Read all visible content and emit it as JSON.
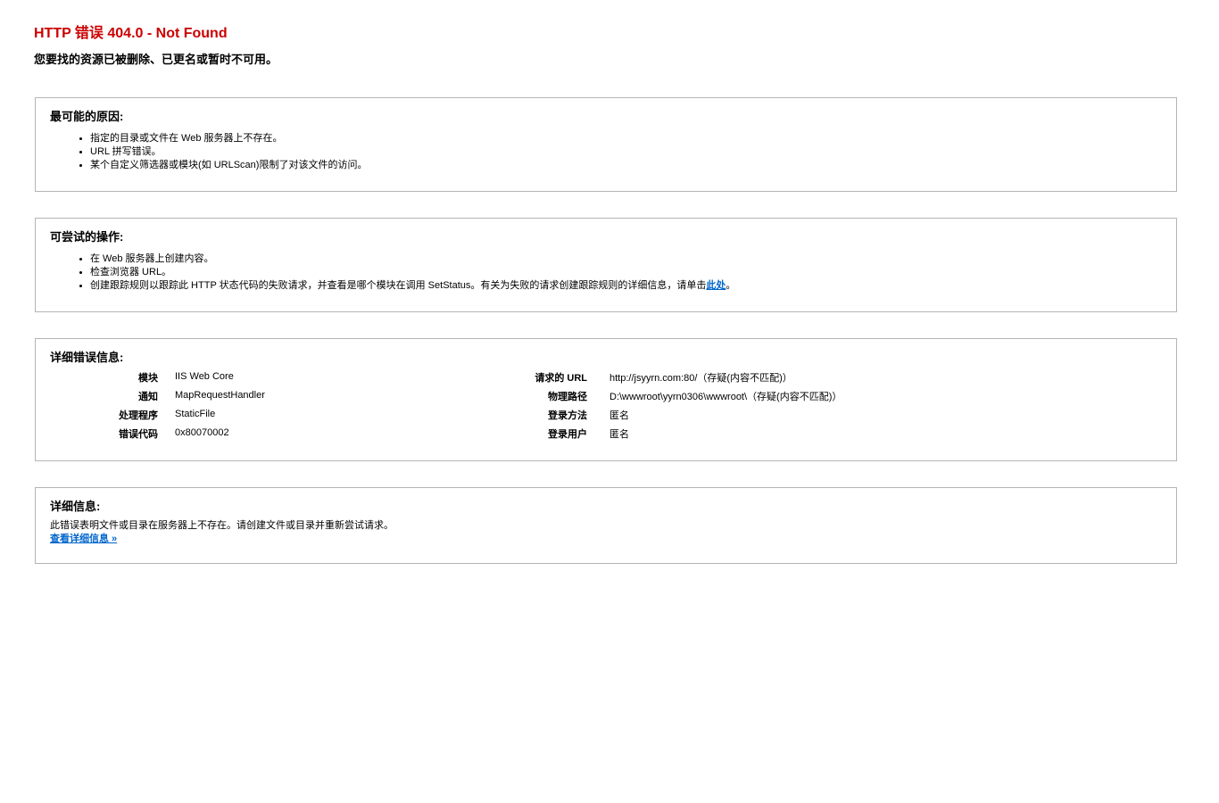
{
  "header": {
    "title": "HTTP 错误 404.0 - Not Found",
    "subtitle": "您要找的资源已被删除、已更名或暂时不可用。"
  },
  "causes": {
    "heading": "最可能的原因:",
    "items": [
      "指定的目录或文件在 Web 服务器上不存在。",
      "URL 拼写错误。",
      "某个自定义筛选器或模块(如 URLScan)限制了对该文件的访问。"
    ]
  },
  "actions": {
    "heading": "可尝试的操作:",
    "items": [
      "在 Web 服务器上创建内容。",
      "检查浏览器 URL。"
    ],
    "trace_text": "创建跟踪规则以跟踪此 HTTP 状态代码的失败请求，并查看是哪个模块在调用 SetStatus。有关为失败的请求创建跟踪规则的详细信息，请单击",
    "trace_link": "此处",
    "trace_end": "。"
  },
  "details": {
    "heading": "详细错误信息:",
    "left": [
      {
        "label": "模块",
        "value": "IIS Web Core"
      },
      {
        "label": "通知",
        "value": "MapRequestHandler"
      },
      {
        "label": "处理程序",
        "value": "StaticFile"
      },
      {
        "label": "错误代码",
        "value": "0x80070002"
      }
    ],
    "right": [
      {
        "label": "请求的 URL",
        "value": "http://jsyyrn.com:80/（存疑(内容不匹配)）"
      },
      {
        "label": "物理路径",
        "value": "D:\\wwwroot\\yyrn0306\\wwwroot\\（存疑(内容不匹配)）"
      },
      {
        "label": "登录方法",
        "value": "匿名"
      },
      {
        "label": "登录用户",
        "value": "匿名"
      }
    ]
  },
  "more_info": {
    "heading": "详细信息:",
    "text": "此错误表明文件或目录在服务器上不存在。请创建文件或目录并重新尝试请求。",
    "link": "查看详细信息 »"
  },
  "colors": {
    "title": "#cc0000",
    "link": "#0066cc",
    "border": "#b4b4b4"
  }
}
